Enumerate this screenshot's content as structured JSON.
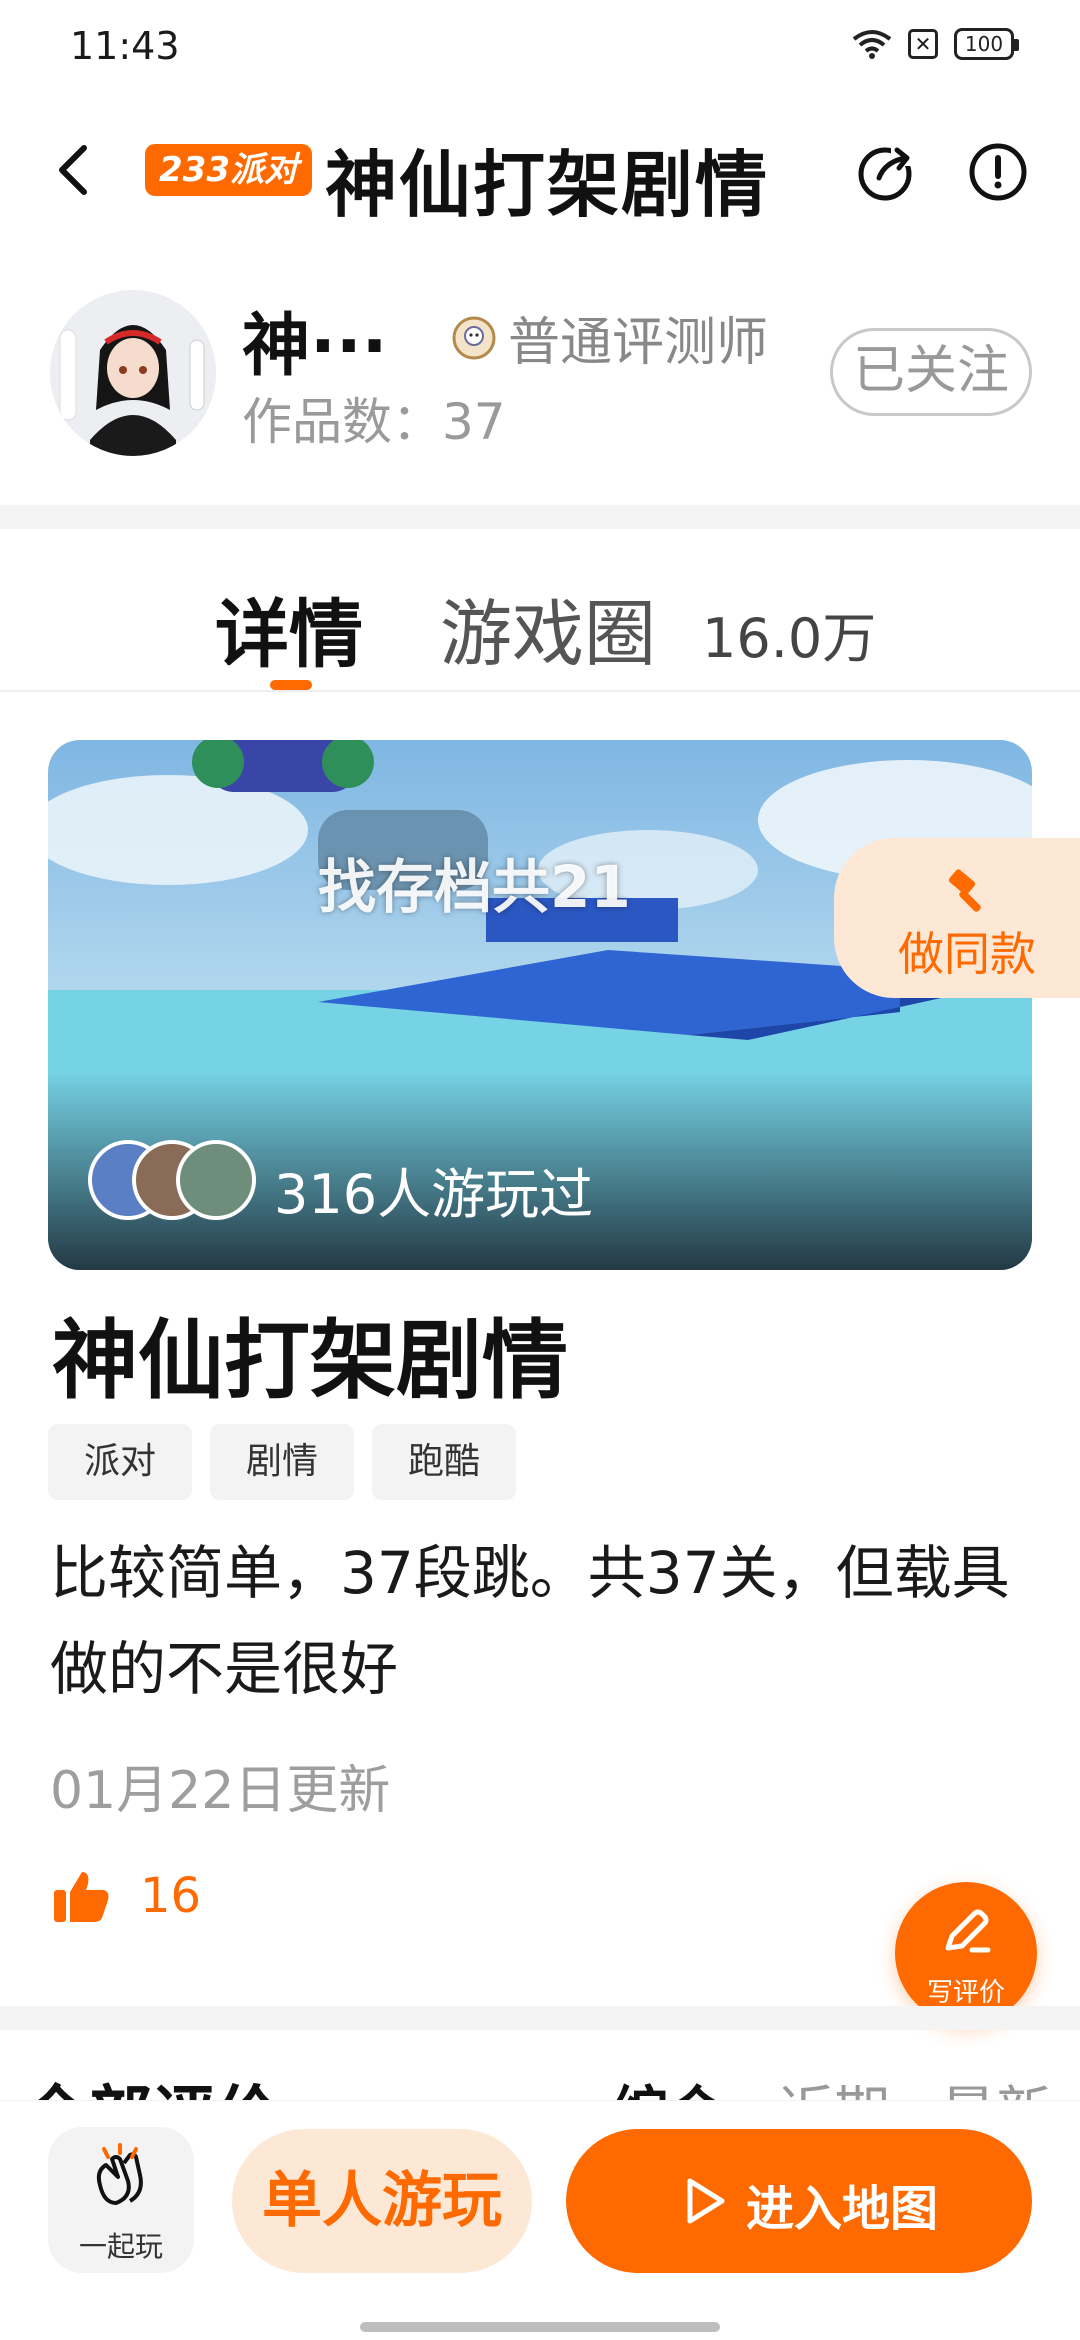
{
  "status_bar": {
    "time": "11:43",
    "battery": "100"
  },
  "header": {
    "badge": "233派对",
    "title": "神仙打架剧情"
  },
  "author": {
    "name": "神···",
    "reviewer_label": "普通评测师",
    "work_count": "作品数：37",
    "follow_label": "已关注"
  },
  "tabs": {
    "detail": "详情",
    "circle": "游戏圈",
    "circle_count": "16.0万"
  },
  "banner": {
    "caption": "找存档共21",
    "played_text": "316人游玩过",
    "same_label": "做同款"
  },
  "game": {
    "title": "神仙打架剧情",
    "tags": [
      "派对",
      "剧情",
      "跑酷"
    ],
    "description": "比较简单，37段跳。共37关，但载具做的不是很好",
    "update": "01月22日更新",
    "likes": "16"
  },
  "write_review_label": "写评价",
  "reviews": {
    "title": "全部评价",
    "sort_options": [
      "综合",
      "近期",
      "最新"
    ]
  },
  "bottom_bar": {
    "play_together": "一起玩",
    "solo_play": "单人游玩",
    "enter_map": "进入地图"
  },
  "colors": {
    "accent": "#ff6a00",
    "accent_light": "#fde8d6"
  },
  "icons": [
    "back-icon",
    "share-icon",
    "info-icon",
    "reviewer-badge-icon",
    "hammer-icon",
    "thumbs-up-icon",
    "pen-icon",
    "clap-icon",
    "play-icon"
  ]
}
